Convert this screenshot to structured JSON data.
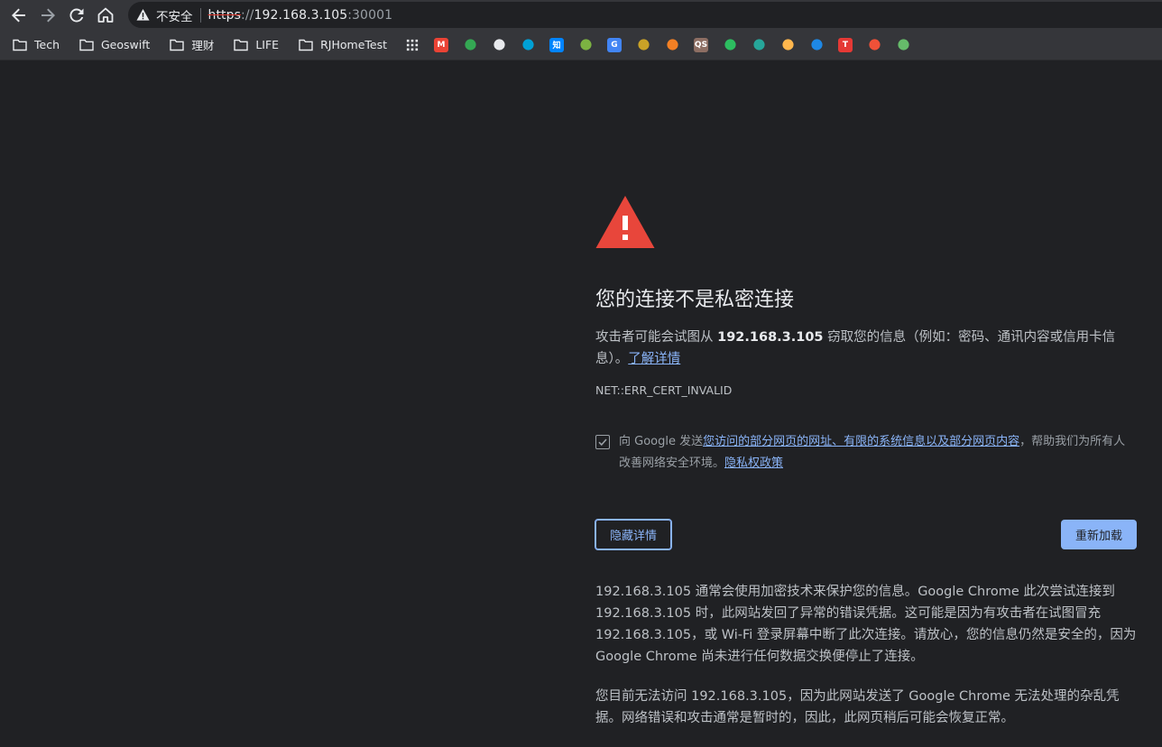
{
  "toolbar": {
    "security_label": "不安全",
    "url_scheme": "https",
    "url_separator": "://",
    "url_host": "192.168.3.105",
    "url_port": ":30001",
    "back_icon": "arrow-back-icon",
    "forward_icon": "arrow-forward-icon",
    "reload_icon": "reload-icon",
    "home_icon": "home-icon",
    "warning_icon": "warning-triangle-icon"
  },
  "bookmarks": {
    "folders": [
      "Tech",
      "Geoswift",
      "理财",
      "LIFE",
      "RJHomeTest"
    ],
    "apps_icon": "apps-grid-icon",
    "icons": [
      {
        "name": "gmail-icon",
        "color": "#ea4335",
        "glyph": "M"
      },
      {
        "name": "leaf-icon",
        "color": "#34a853",
        "glyph": ""
      },
      {
        "name": "github-icon",
        "color": "#e8eaed",
        "glyph": ""
      },
      {
        "name": "bilibili-icon",
        "color": "#00a1d6",
        "glyph": ""
      },
      {
        "name": "zhihu-icon",
        "color": "#0084ff",
        "glyph": "知"
      },
      {
        "name": "circle-green-icon",
        "color": "#7cb342",
        "glyph": ""
      },
      {
        "name": "google-translate-icon",
        "color": "#4285f4",
        "glyph": "G"
      },
      {
        "name": "pixel-image-icon",
        "color": "#c9a227",
        "glyph": ""
      },
      {
        "name": "stackoverflow-icon",
        "color": "#f48024",
        "glyph": ""
      },
      {
        "name": "qs-icon",
        "color": "#8d6e63",
        "glyph": "QS"
      },
      {
        "name": "evernote-icon",
        "color": "#2dbe60",
        "glyph": ""
      },
      {
        "name": "ring-icon",
        "color": "#26a69a",
        "glyph": ""
      },
      {
        "name": "hand-icon",
        "color": "#ffb74d",
        "glyph": ""
      },
      {
        "name": "wave-icon",
        "color": "#1e88e5",
        "glyph": ""
      },
      {
        "name": "t-logo-icon",
        "color": "#e53935",
        "glyph": "T"
      },
      {
        "name": "swift-icon",
        "color": "#f05138",
        "glyph": ""
      },
      {
        "name": "tl-icon",
        "color": "#66bb6a",
        "glyph": ""
      }
    ]
  },
  "interstitial": {
    "icon": "danger-triangle-icon",
    "heading": "您的连接不是私密连接",
    "explanation_prefix": "攻击者可能会试图从 ",
    "explanation_host": "192.168.3.105",
    "explanation_suffix": " 窃取您的信息（例如：密码、通讯内容或信用卡信息）。",
    "learn_more_link": "了解详情",
    "error_code": "NET::ERR_CERT_INVALID",
    "optin_prefix": "向 Google 发送",
    "optin_link": "您访问的部分网页的网址、有限的系统信息以及部分网页内容",
    "optin_suffix": "，帮助我们为所有人改善网络安全环境。",
    "privacy_link": "隐私权政策",
    "optin_checked": true,
    "hide_details_button": "隐藏详情",
    "reload_button": "重新加载",
    "details_paragraph_1": "192.168.3.105 通常会使用加密技术来保护您的信息。Google Chrome 此次尝试连接到 192.168.3.105 时，此网站发回了异常的错误凭据。这可能是因为有攻击者在试图冒充 192.168.3.105，或 Wi-Fi 登录屏幕中断了此次连接。请放心，您的信息仍然是安全的，因为 Google Chrome 尚未进行任何数据交换便停止了连接。",
    "details_paragraph_2": "您目前无法访问 192.168.3.105，因为此网站发送了 Google Chrome 无法处理的杂乱凭据。网络错误和攻击通常是暂时的，因此，此网页稍后可能会恢复正常。"
  }
}
